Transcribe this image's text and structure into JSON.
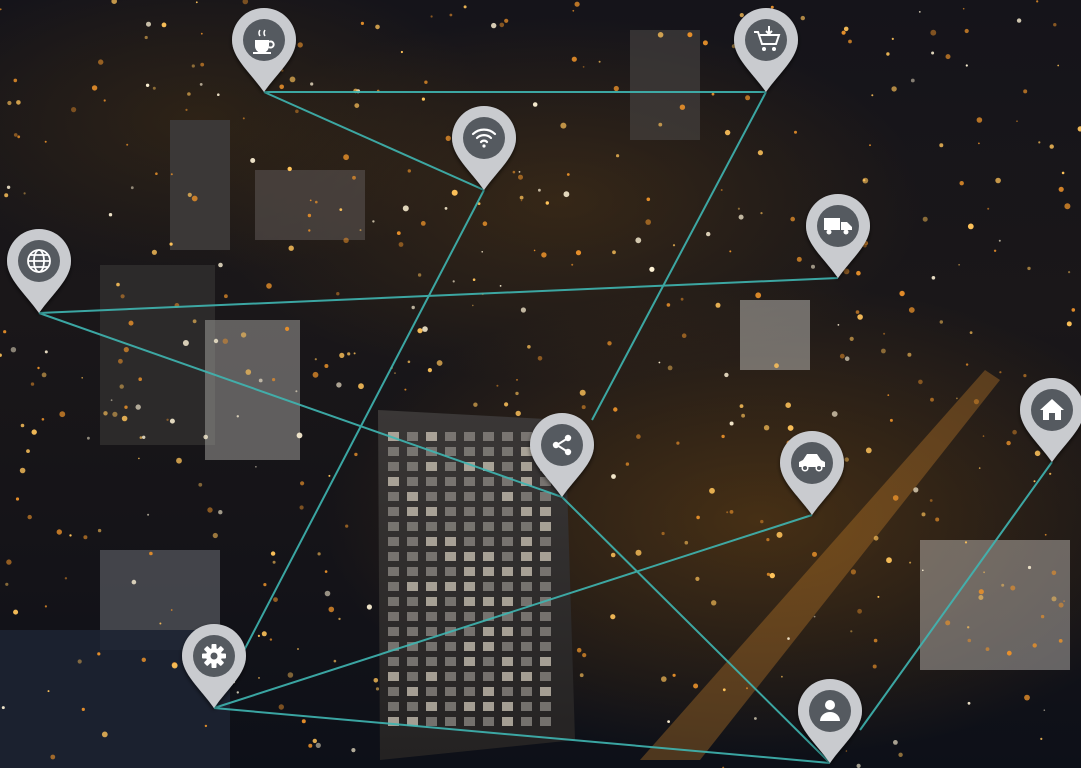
{
  "photo": {
    "description_type": "night aerial city with location-pin network overlay",
    "line_color": "#3fb6b2",
    "pin_color": "#c9cbcf",
    "pin_icon_bg": "#555a60"
  },
  "pins": [
    {
      "icon": "coffee-cup-icon"
    },
    {
      "icon": "shopping-cart-icon"
    },
    {
      "icon": "wifi-icon"
    },
    {
      "icon": "delivery-truck-icon"
    },
    {
      "icon": "globe-icon"
    },
    {
      "icon": "share-icon"
    },
    {
      "icon": "car-icon"
    },
    {
      "icon": "home-icon"
    },
    {
      "icon": "gear-icon"
    },
    {
      "icon": "user-icon"
    }
  ]
}
